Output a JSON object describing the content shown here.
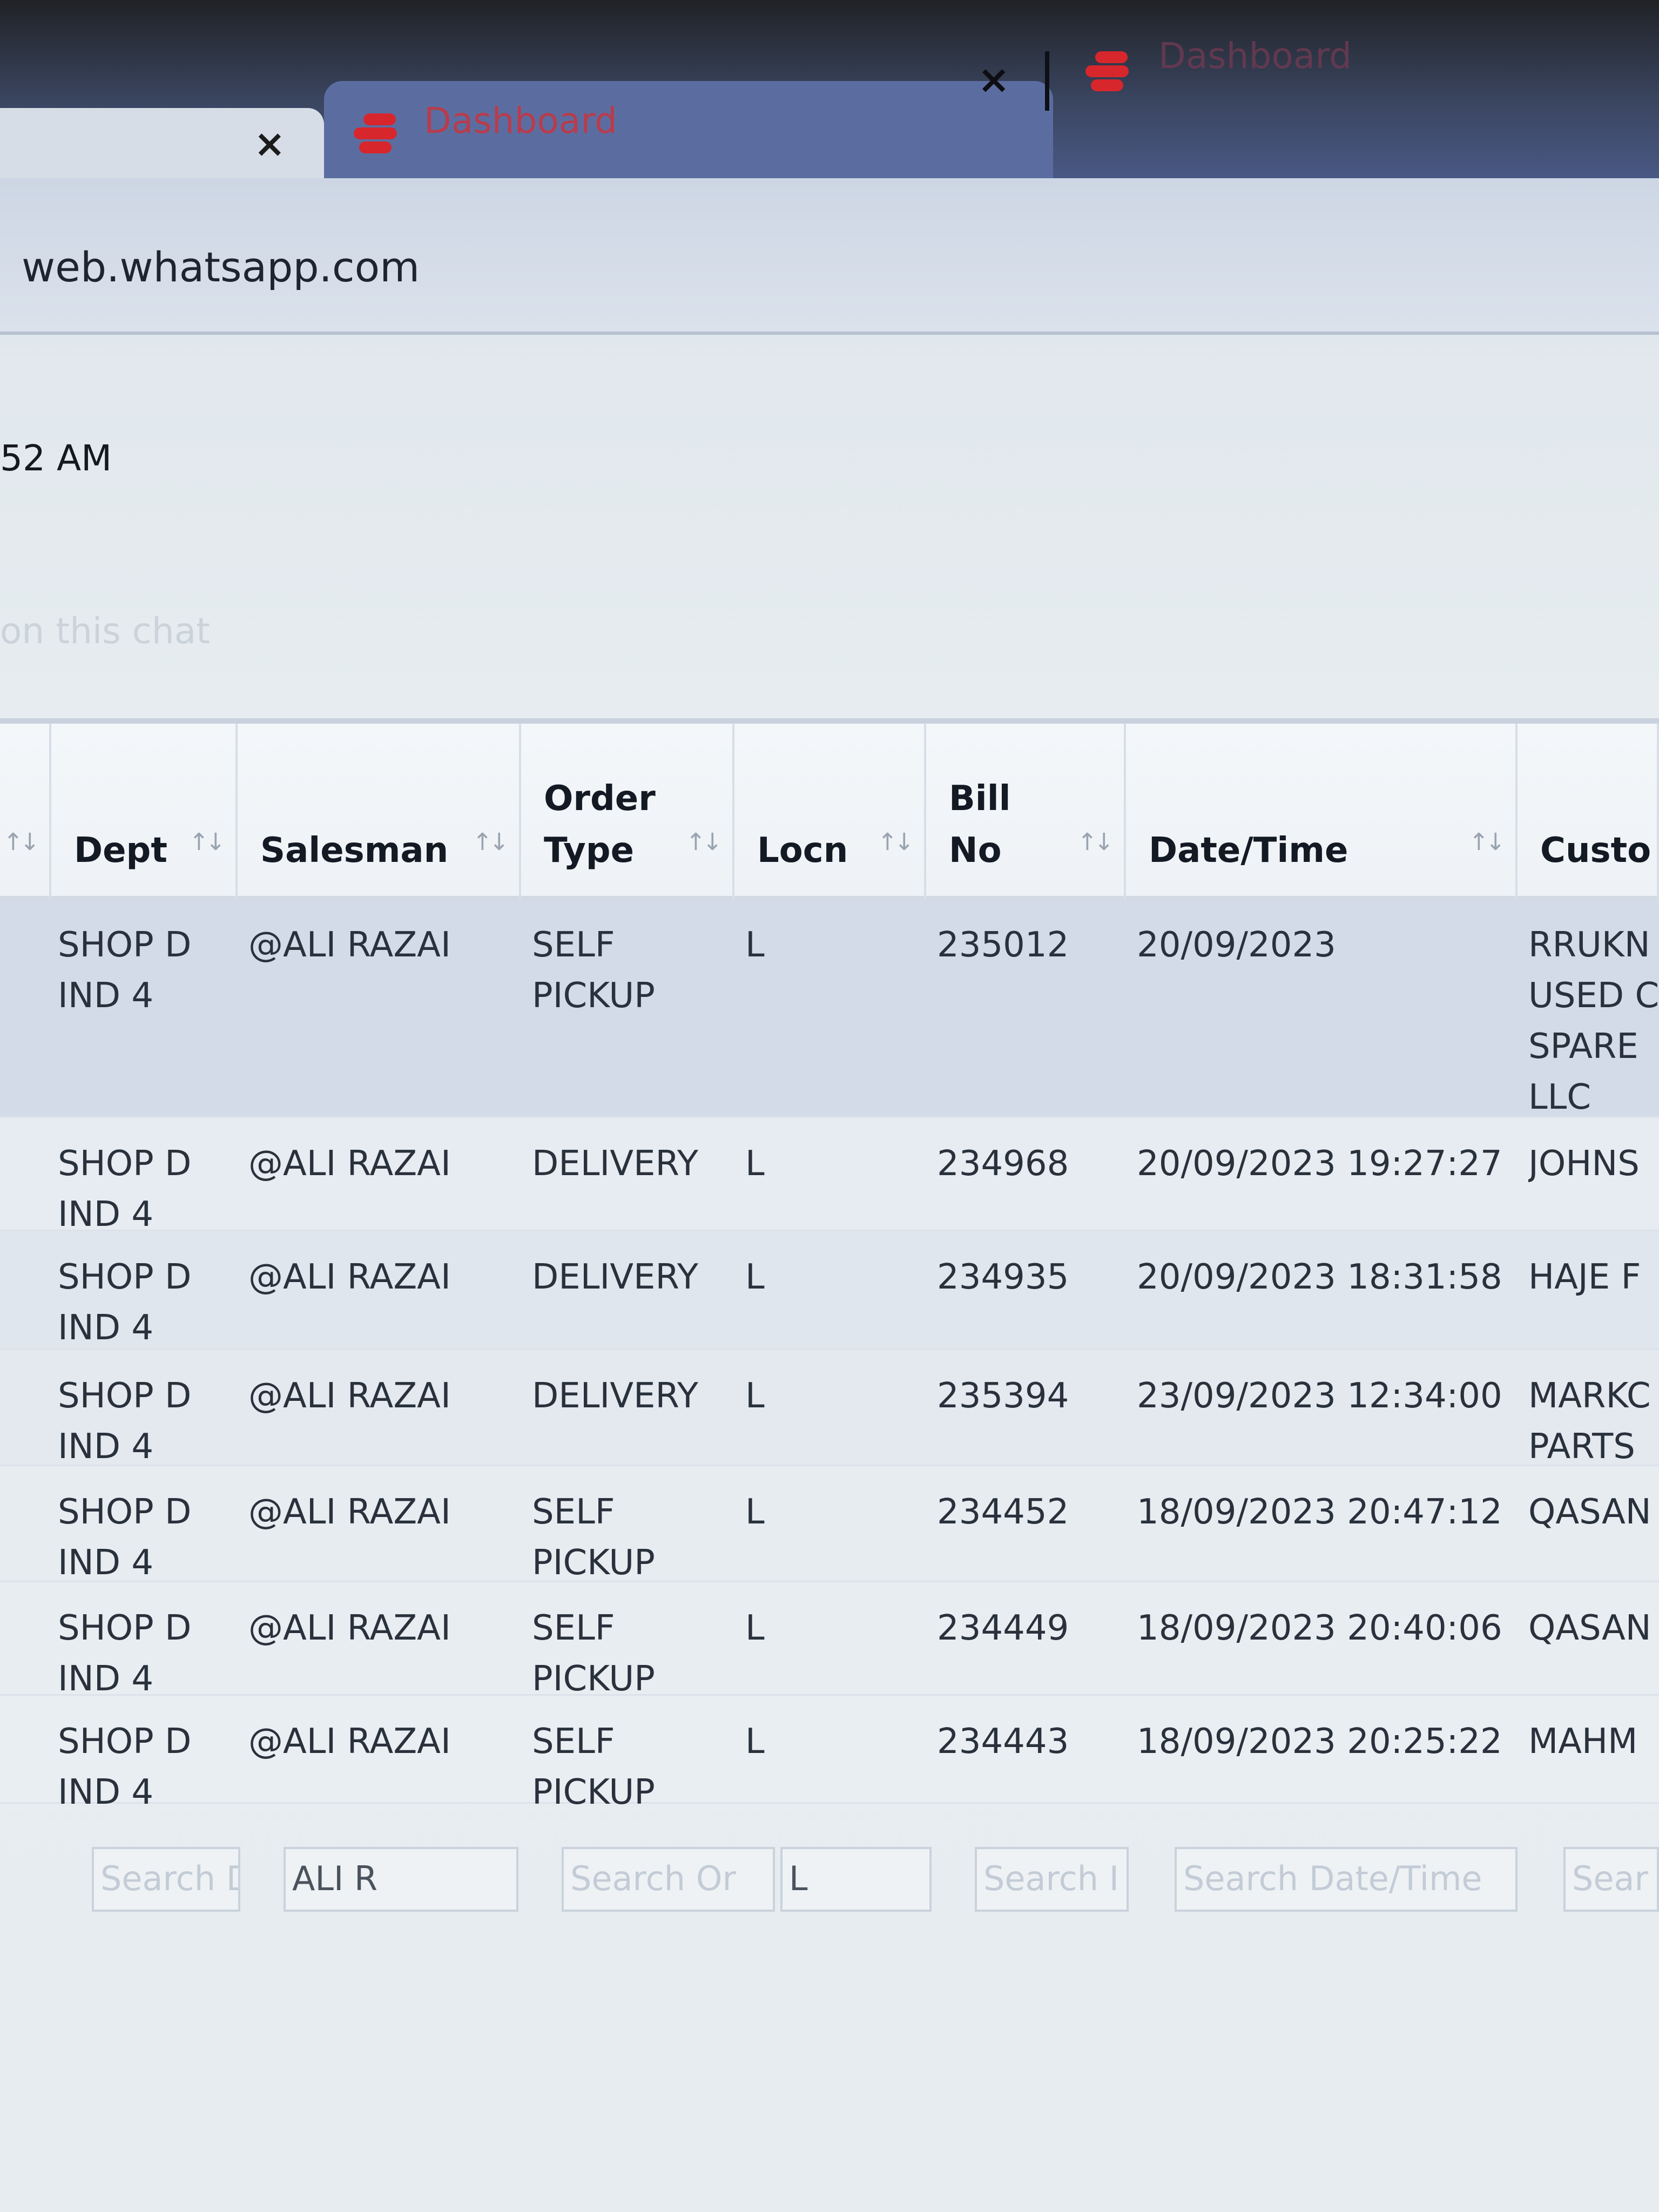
{
  "browser": {
    "tabs": [
      {
        "title": "Dashboard",
        "close_label": "×"
      },
      {
        "title": "Dashboard",
        "close_label": "×"
      }
    ],
    "url": "web.whatsapp.com"
  },
  "page": {
    "time_fragment": "52 AM",
    "faint_text": "on this chat"
  },
  "table": {
    "columns": [
      "",
      "Dept",
      "Salesman",
      "Order\nType",
      "Locn",
      "Bill\nNo",
      "Date/Time",
      "Custo"
    ],
    "sort_glyph": "↑↓",
    "rows": [
      {
        "dept": "SHOP D\nIND 4",
        "salesman": "@ALI RAZAI",
        "order_type": "SELF\nPICKUP",
        "locn": "L",
        "bill_no": "235012",
        "datetime": "20/09/2023",
        "customer": "RRUKN\nUSED C\nSPARE\nLLC"
      },
      {
        "dept": "SHOP D\nIND 4",
        "salesman": "@ALI RAZAI",
        "order_type": "DELIVERY",
        "locn": "L",
        "bill_no": "234968",
        "datetime": "20/09/2023 19:27:27",
        "customer": "JOHNS"
      },
      {
        "dept": "SHOP D\nIND 4",
        "salesman": "@ALI RAZAI",
        "order_type": "DELIVERY",
        "locn": "L",
        "bill_no": "234935",
        "datetime": "20/09/2023 18:31:58",
        "customer": "HAJE F"
      },
      {
        "dept": "SHOP D\nIND 4",
        "salesman": "@ALI RAZAI",
        "order_type": "DELIVERY",
        "locn": "L",
        "bill_no": "235394",
        "datetime": "23/09/2023 12:34:00",
        "customer": "MARKC\nPARTS"
      },
      {
        "dept": "SHOP D\nIND 4",
        "salesman": "@ALI RAZAI",
        "order_type": "SELF\nPICKUP",
        "locn": "L",
        "bill_no": "234452",
        "datetime": "18/09/2023 20:47:12",
        "customer": "QASAN"
      },
      {
        "dept": "SHOP D\nIND 4",
        "salesman": "@ALI RAZAI",
        "order_type": "SELF\nPICKUP",
        "locn": "L",
        "bill_no": "234449",
        "datetime": "18/09/2023 20:40:06",
        "customer": "QASAN"
      },
      {
        "dept": "SHOP D\nIND 4",
        "salesman": "@ALI RAZAI",
        "order_type": "SELF\nPICKUP",
        "locn": "L",
        "bill_no": "234443",
        "datetime": "18/09/2023 20:25:22",
        "customer": "MAHM"
      }
    ],
    "filters": [
      {
        "value": "",
        "placeholder": "Search D"
      },
      {
        "value": "ALI R",
        "placeholder": ""
      },
      {
        "value": "",
        "placeholder": "Search Or"
      },
      {
        "value": "L",
        "placeholder": ""
      },
      {
        "value": "",
        "placeholder": "Search I"
      },
      {
        "value": "",
        "placeholder": "Search Date/Time"
      },
      {
        "value": "",
        "placeholder": "Sear"
      }
    ]
  }
}
